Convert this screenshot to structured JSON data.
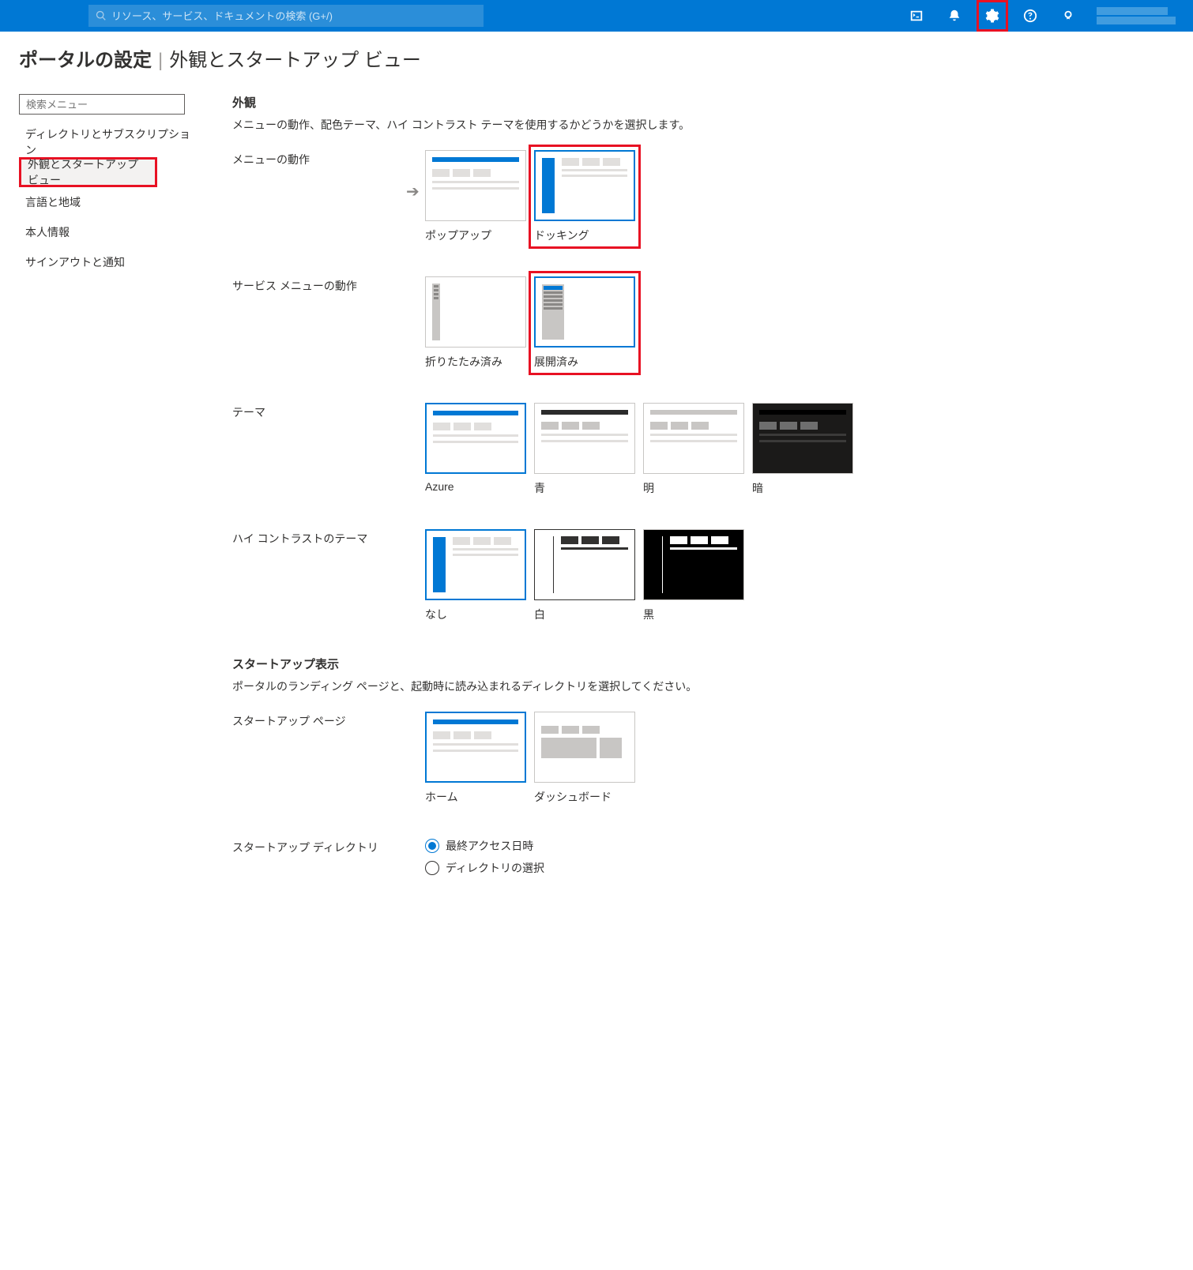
{
  "topbar": {
    "search_placeholder": "リソース、サービス、ドキュメントの検索 (G+/)"
  },
  "page": {
    "title": "ポータルの設定",
    "subtitle": "外観とスタートアップ ビュー"
  },
  "sidebar": {
    "search_placeholder": "検索メニュー",
    "items": [
      "ディレクトリとサブスクリプション",
      "外観とスタートアップ ビュー",
      "言語と地域",
      "本人情報",
      "サインアウトと通知"
    ]
  },
  "sections": {
    "appearance": {
      "title": "外観",
      "desc": "メニューの動作、配色テーマ、ハイ コントラスト テーマを使用するかどうかを選択します。"
    },
    "menu_behavior": {
      "label": "メニューの動作",
      "options": {
        "flyout": "ポップアップ",
        "docked": "ドッキング"
      }
    },
    "service_menu": {
      "label": "サービス メニューの動作",
      "options": {
        "collapsed": "折りたたみ済み",
        "expanded": "展開済み"
      }
    },
    "theme": {
      "label": "テーマ",
      "options": {
        "azure": "Azure",
        "blue": "青",
        "light": "明",
        "dark": "暗"
      }
    },
    "contrast": {
      "label": "ハイ コントラストのテーマ",
      "options": {
        "none": "なし",
        "white": "白",
        "black": "黒"
      }
    },
    "startup": {
      "title": "スタートアップ表示",
      "desc": "ポータルのランディング ページと、起動時に読み込まれるディレクトリを選択してください。"
    },
    "startup_page": {
      "label": "スタートアップ ページ",
      "options": {
        "home": "ホーム",
        "dashboard": "ダッシュボード"
      }
    },
    "startup_dir": {
      "label": "スタートアップ ディレクトリ",
      "options": {
        "last": "最終アクセス日時",
        "select": "ディレクトリの選択"
      }
    }
  }
}
